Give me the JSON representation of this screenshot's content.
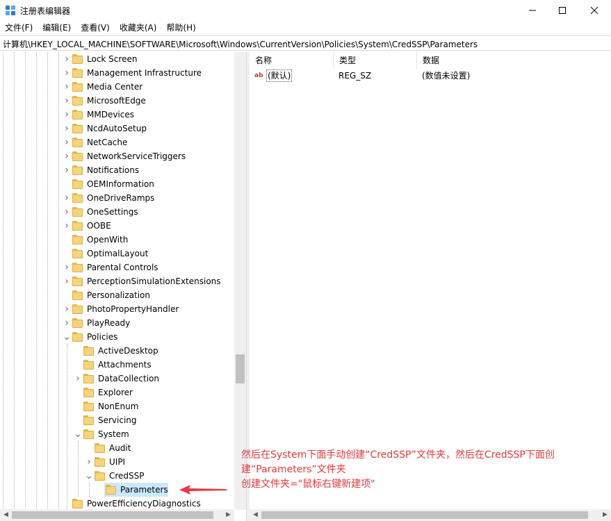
{
  "window": {
    "title": "注册表编辑器",
    "icon": "regedit-icon"
  },
  "menu": [
    "文件(F)",
    "编辑(E)",
    "查看(V)",
    "收藏夹(A)",
    "帮助(H)"
  ],
  "address": "计算机\\HKEY_LOCAL_MACHINE\\SOFTWARE\\Microsoft\\Windows\\CurrentVersion\\Policies\\System\\CredSSP\\Parameters",
  "tree": {
    "items": [
      {
        "label": "Lock Screen",
        "level": 0,
        "arrow": "collapsed"
      },
      {
        "label": "Management Infrastructure",
        "level": 0,
        "arrow": "collapsed"
      },
      {
        "label": "Media Center",
        "level": 0,
        "arrow": "collapsed"
      },
      {
        "label": "MicrosoftEdge",
        "level": 0,
        "arrow": "collapsed"
      },
      {
        "label": "MMDevices",
        "level": 0,
        "arrow": "collapsed"
      },
      {
        "label": "NcdAutoSetup",
        "level": 0,
        "arrow": "collapsed"
      },
      {
        "label": "NetCache",
        "level": 0,
        "arrow": "collapsed"
      },
      {
        "label": "NetworkServiceTriggers",
        "level": 0,
        "arrow": "collapsed"
      },
      {
        "label": "Notifications",
        "level": 0,
        "arrow": "collapsed"
      },
      {
        "label": "OEMInformation",
        "level": 0,
        "arrow": "none"
      },
      {
        "label": "OneDriveRamps",
        "level": 0,
        "arrow": "collapsed"
      },
      {
        "label": "OneSettings",
        "level": 0,
        "arrow": "collapsed"
      },
      {
        "label": "OOBE",
        "level": 0,
        "arrow": "collapsed"
      },
      {
        "label": "OpenWith",
        "level": 0,
        "arrow": "none"
      },
      {
        "label": "OptimalLayout",
        "level": 0,
        "arrow": "none"
      },
      {
        "label": "Parental Controls",
        "level": 0,
        "arrow": "collapsed"
      },
      {
        "label": "PerceptionSimulationExtensions",
        "level": 0,
        "arrow": "collapsed"
      },
      {
        "label": "Personalization",
        "level": 0,
        "arrow": "none"
      },
      {
        "label": "PhotoPropertyHandler",
        "level": 0,
        "arrow": "collapsed"
      },
      {
        "label": "PlayReady",
        "level": 0,
        "arrow": "collapsed"
      },
      {
        "label": "Policies",
        "level": 0,
        "arrow": "expanded"
      },
      {
        "label": "ActiveDesktop",
        "level": 1,
        "arrow": "none"
      },
      {
        "label": "Attachments",
        "level": 1,
        "arrow": "none"
      },
      {
        "label": "DataCollection",
        "level": 1,
        "arrow": "collapsed"
      },
      {
        "label": "Explorer",
        "level": 1,
        "arrow": "none"
      },
      {
        "label": "NonEnum",
        "level": 1,
        "arrow": "none"
      },
      {
        "label": "Servicing",
        "level": 1,
        "arrow": "none"
      },
      {
        "label": "System",
        "level": 1,
        "arrow": "expanded"
      },
      {
        "label": "Audit",
        "level": 2,
        "arrow": "none"
      },
      {
        "label": "UIPI",
        "level": 2,
        "arrow": "collapsed"
      },
      {
        "label": "CredSSP",
        "level": 2,
        "arrow": "expanded"
      },
      {
        "label": "Parameters",
        "level": 3,
        "arrow": "none",
        "selected": true
      },
      {
        "label": "PowerEfficiencyDiagnostics",
        "level": 0,
        "arrow": "none"
      }
    ]
  },
  "values": {
    "headers": {
      "name": "名称",
      "type": "类型",
      "data": "数据"
    },
    "rows": [
      {
        "icon": "ab",
        "name": "(默认)",
        "type": "REG_SZ",
        "data": "(数值未设置)"
      }
    ]
  },
  "annotation": {
    "line1": "然后在System下面手动创建“CredSSP”文件夹，然后在CredSSP下面创",
    "line2": "建“Parameters”文件夹",
    "line3": "创建文件夹=\"鼠标右键新建项\"",
    "color": "#e8383d"
  }
}
